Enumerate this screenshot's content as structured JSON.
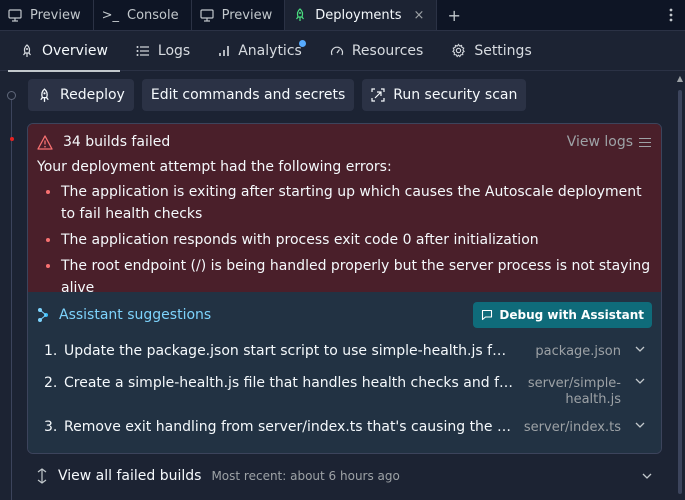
{
  "tabs": [
    {
      "label": "Preview",
      "icon": "monitor-icon"
    },
    {
      "label": "Console",
      "icon": "terminal-icon"
    },
    {
      "label": "Preview",
      "icon": "monitor-icon"
    },
    {
      "label": "Deployments",
      "icon": "rocket-icon",
      "active": true,
      "close": "×"
    }
  ],
  "tab_add": "+",
  "nav": {
    "overview": "Overview",
    "logs": "Logs",
    "analytics": "Analytics",
    "resources": "Resources",
    "settings": "Settings"
  },
  "actions": {
    "redeploy": "Redeploy",
    "edit": "Edit commands and secrets",
    "scan": "Run security scan"
  },
  "error": {
    "title": "34 builds failed",
    "view_logs": "View logs",
    "subtitle": "Your deployment attempt had the following errors:",
    "items": [
      "The application is exiting after starting up which causes the Autoscale deployment to fail health checks",
      "The application responds with process exit code 0 after initialization",
      "The root endpoint (/) is being handled properly but the server process is not staying alive"
    ]
  },
  "assistant": {
    "title": "Assistant suggestions",
    "debug_button": "Debug with Assistant",
    "suggestions": [
      {
        "num": "1.",
        "text": "Update the package.json start script to use simple-health.js for production",
        "file": "package.json"
      },
      {
        "num": "2.",
        "text": "Create a simple-health.js file that handles health checks and forwards...",
        "file": "server/simple-health.js",
        "file_line1": "server/simple-",
        "file_line2": "health.js"
      },
      {
        "num": "3.",
        "text": "Remove exit handling from server/index.ts that's causing the main...",
        "file": "server/index.ts"
      }
    ]
  },
  "footer": {
    "title": "View all failed builds",
    "subtitle": "Most recent: about 6 hours ago"
  },
  "colors": {
    "background": "#1c2333",
    "error_bg": "#4a1f2a",
    "assist_bg": "#223243",
    "accent": "#7dd3fc",
    "debug_button": "#0f6b7a",
    "badge": "#57abff"
  }
}
